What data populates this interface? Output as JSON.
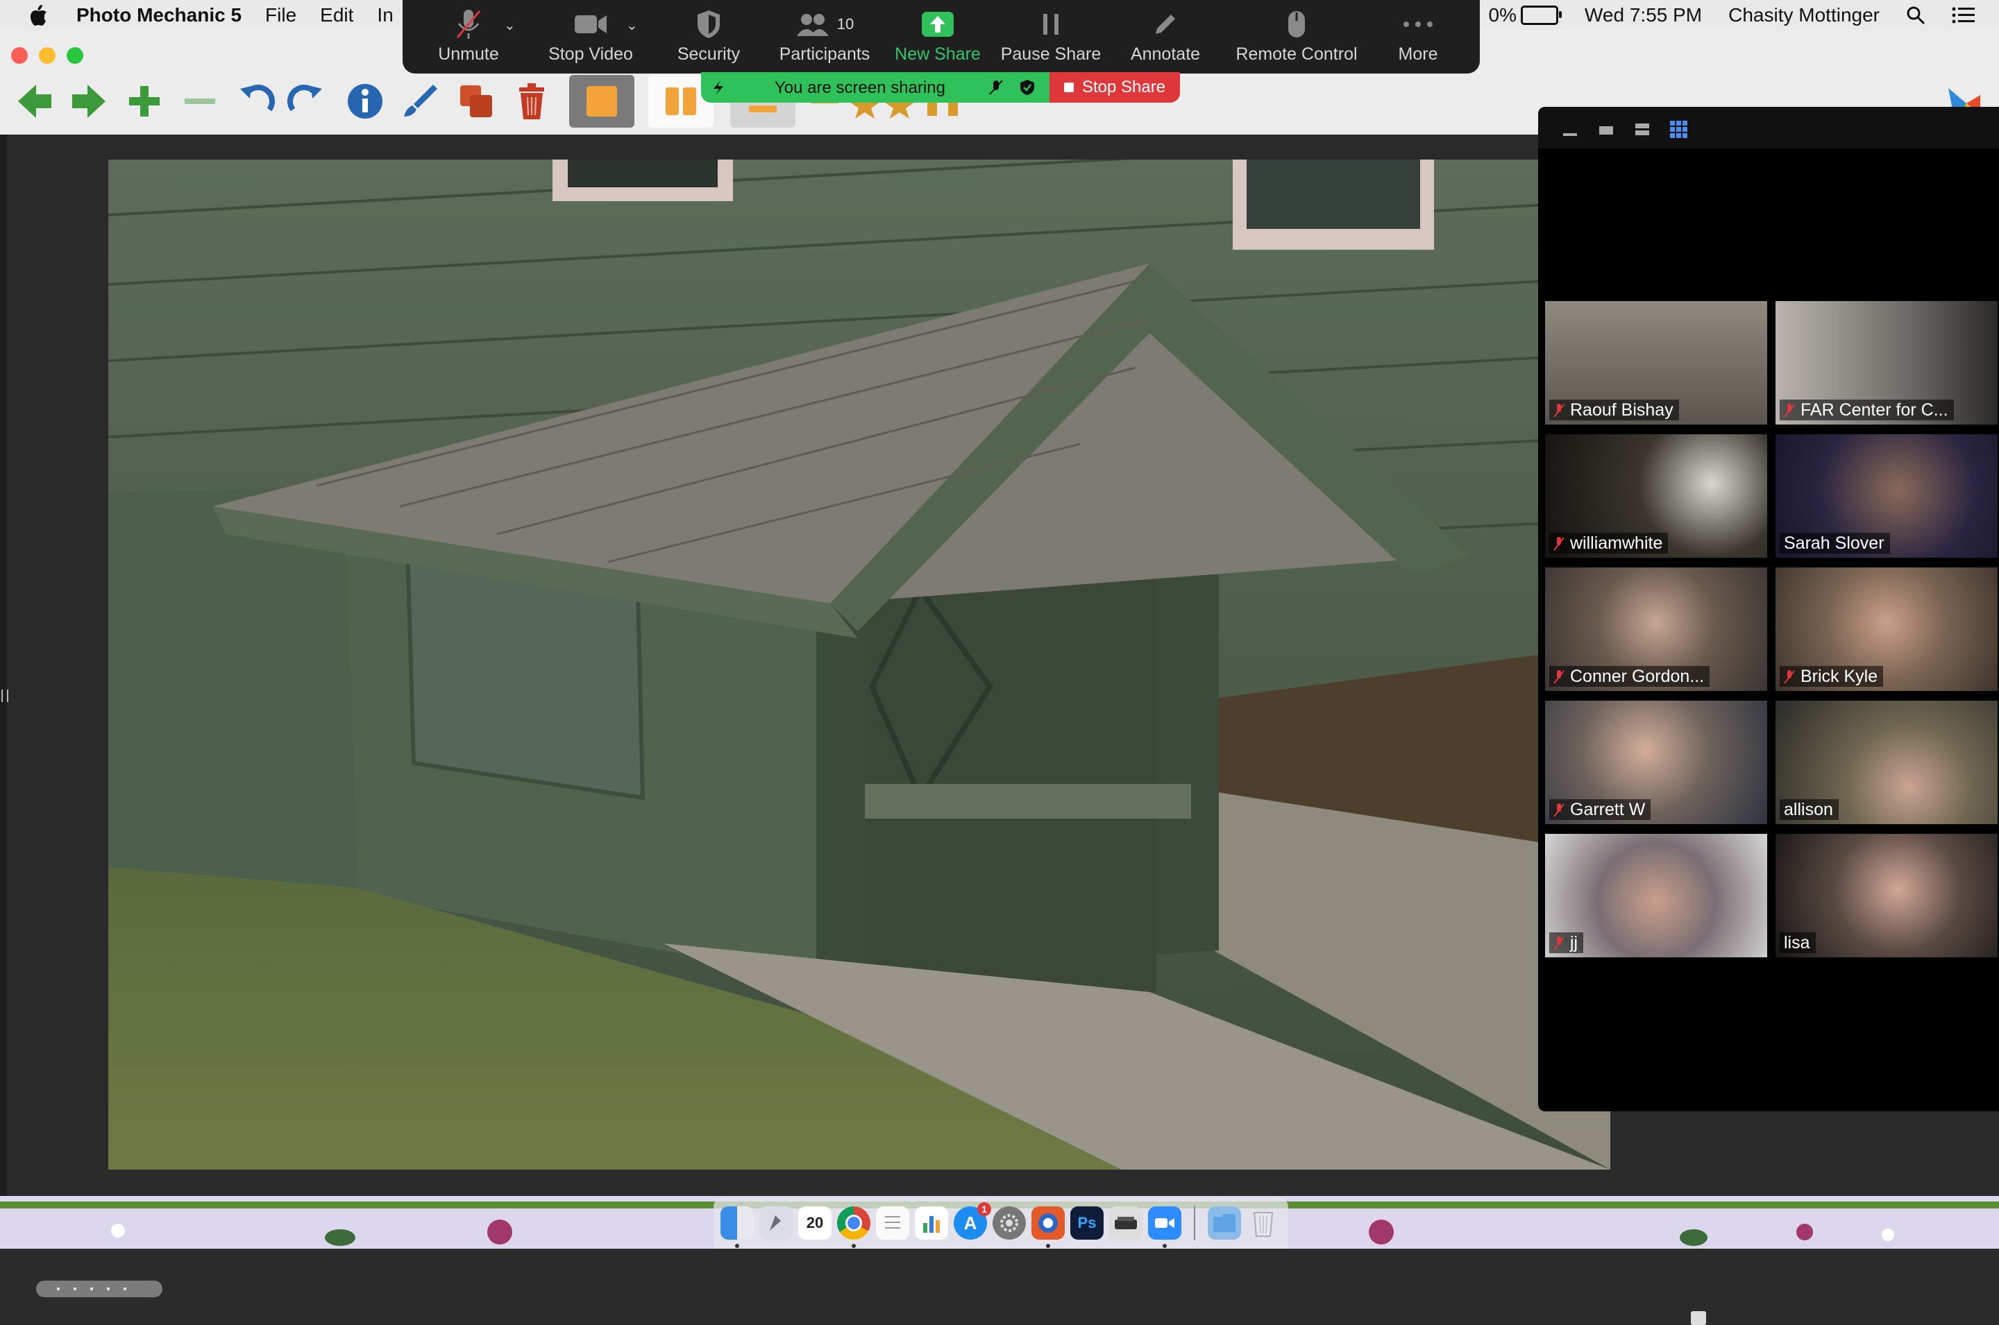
{
  "menubar": {
    "app_name": "Photo Mechanic 5",
    "menus": [
      "File",
      "Edit",
      "In"
    ],
    "battery_text": "0%",
    "clock": "Wed 7:55 PM",
    "user": "Chasity Mottinger"
  },
  "zoom_controls": {
    "buttons": [
      {
        "label": "Unmute",
        "icon": "mic-muted-icon"
      },
      {
        "label": "Stop Video",
        "icon": "video-camera-icon"
      },
      {
        "label": "Security",
        "icon": "shield-icon"
      },
      {
        "label": "Participants",
        "icon": "participants-icon",
        "count": "10"
      },
      {
        "label": "New Share",
        "icon": "share-arrow-icon"
      },
      {
        "label": "Pause Share",
        "icon": "pause-icon"
      },
      {
        "label": "Annotate",
        "icon": "pencil-icon"
      },
      {
        "label": "Remote Control",
        "icon": "mouse-icon"
      },
      {
        "label": "More",
        "icon": "ellipsis-icon"
      }
    ],
    "sharing_banner": "You are screen sharing",
    "stop_share": "Stop Share",
    "accent_green": "#36c46c",
    "stop_red": "#e0383a"
  },
  "gallery": {
    "participants": [
      {
        "name": "Raouf Bishay",
        "muted": true
      },
      {
        "name": "FAR Center for C...",
        "muted": true
      },
      {
        "name": "williamwhite",
        "muted": true
      },
      {
        "name": "Sarah Slover",
        "muted": false
      },
      {
        "name": "Conner Gordon...",
        "muted": true
      },
      {
        "name": "Brick Kyle",
        "muted": true
      },
      {
        "name": "Garrett W",
        "muted": true
      },
      {
        "name": "allison",
        "muted": false,
        "active_speaker": true
      },
      {
        "name": "jj",
        "muted": true
      },
      {
        "name": "lisa",
        "muted": false
      }
    ]
  },
  "dock": {
    "calendar_day": "20",
    "appstore_badge": "1",
    "photoshop": "Ps"
  }
}
